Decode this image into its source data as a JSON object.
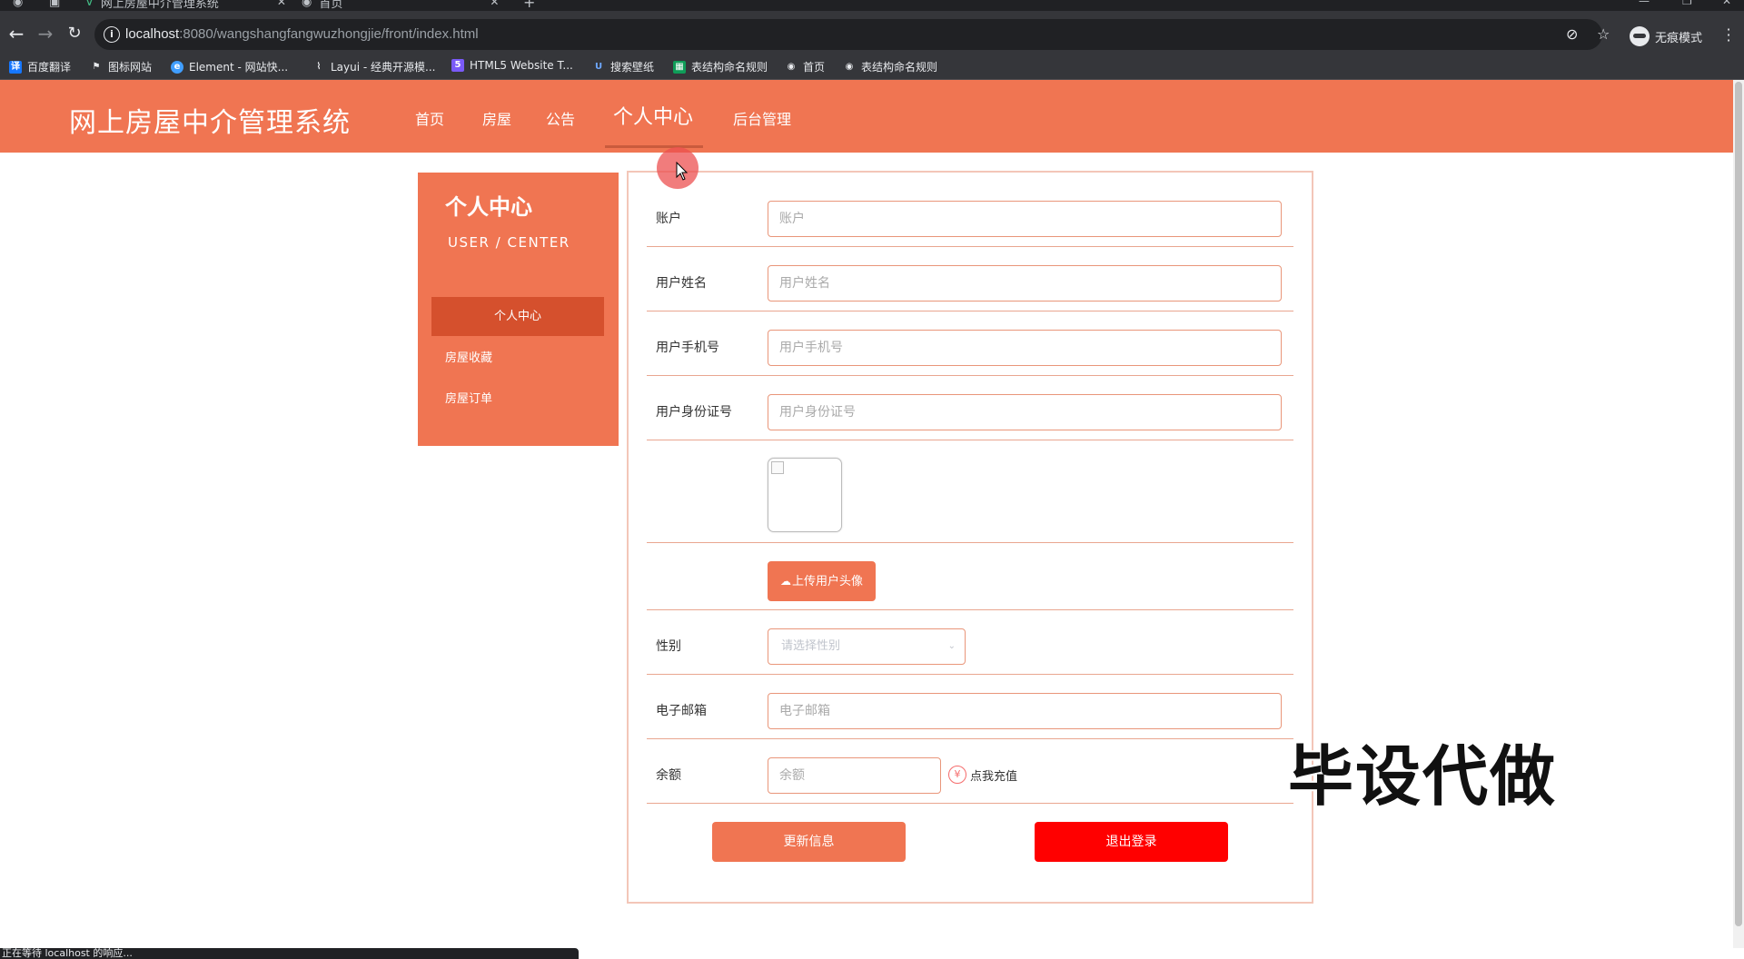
{
  "browser": {
    "tabs": [
      {
        "title": "网上房屋中介管理系统"
      },
      {
        "title": "首页"
      }
    ],
    "url_host": "localhost",
    "url_rest": ":8080/wangshangfangwuzhongjie/front/index.html",
    "incognito_label": "无痕模式",
    "bookmarks": [
      {
        "label": "百度翻译",
        "icon": "translate-icon"
      },
      {
        "label": "图标网站",
        "icon": "flag-icon"
      },
      {
        "label": "Element - 网站快...",
        "icon": "element-icon"
      },
      {
        "label": "Layui - 经典开源模...",
        "icon": "layui-icon"
      },
      {
        "label": "HTML5 Website T...",
        "icon": "html5-icon"
      },
      {
        "label": "搜索壁纸",
        "icon": "wallpaper-icon"
      },
      {
        "label": "表结构命名规则",
        "icon": "sheet-icon"
      },
      {
        "label": "首页",
        "icon": "globe-icon"
      },
      {
        "label": "表结构命名规则",
        "icon": "globe-icon"
      }
    ],
    "status_text": "正在等待 localhost 的响应..."
  },
  "header": {
    "site_title": "网上房屋中介管理系统",
    "nav": [
      {
        "label": "首页"
      },
      {
        "label": "房屋"
      },
      {
        "label": "公告"
      },
      {
        "label": "个人中心"
      },
      {
        "label": "后台管理"
      }
    ]
  },
  "sidebar": {
    "title": "个人中心",
    "subtitle": "USER / CENTER",
    "items": [
      {
        "label": "个人中心"
      },
      {
        "label": "房屋收藏"
      },
      {
        "label": "房屋订单"
      }
    ]
  },
  "form": {
    "account": {
      "label": "账户",
      "placeholder": "账户"
    },
    "name": {
      "label": "用户姓名",
      "placeholder": "用户姓名"
    },
    "phone": {
      "label": "用户手机号",
      "placeholder": "用户手机号"
    },
    "idcard": {
      "label": "用户身份证号",
      "placeholder": "用户身份证号"
    },
    "upload_label": "上传用户头像",
    "gender": {
      "label": "性别",
      "placeholder": "请选择性别"
    },
    "email": {
      "label": "电子邮箱",
      "placeholder": "电子邮箱"
    },
    "balance": {
      "label": "余额",
      "placeholder": "余额"
    },
    "recharge_label": "点我充值",
    "update_button": "更新信息",
    "logout_button": "退出登录"
  },
  "overlay": {
    "watermark": "毕设代做"
  },
  "colors": {
    "brand": "#f07552",
    "sidebar_active": "#d5502d",
    "danger": "#ff0000"
  }
}
